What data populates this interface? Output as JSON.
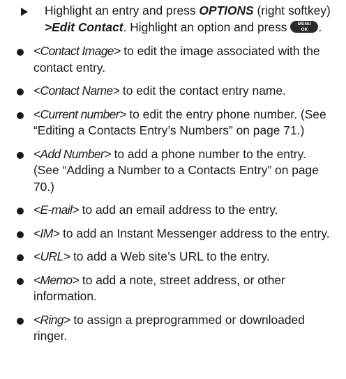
{
  "step": {
    "part1": "Highlight an entry and press ",
    "options_label": "OPTIONS",
    "part2": " (right softkey) ",
    "edit_contact_label": ">Edit Contact",
    "part3": ". Highlight an option and press ",
    "menu_key_top": "MENU",
    "menu_key_bottom": "OK",
    "part4": "."
  },
  "options": [
    {
      "token": "<Contact Image>",
      "desc": " to edit the image associated with the contact entry."
    },
    {
      "token": "<Contact Name>",
      "desc": " to edit the contact entry name."
    },
    {
      "token": "<Current number>",
      "desc": " to edit the entry phone number. (See “Editing a Contacts Entry’s Numbers” on page 71.)"
    },
    {
      "token": "<Add Number>",
      "desc": " to add a phone number to the entry. (See “Adding a Number to a Contacts Entry” on page 70.)"
    },
    {
      "token": "<E-mail>",
      "desc": " to add an email address to the entry."
    },
    {
      "token": "<IM>",
      "desc": " to add an Instant Messenger address to the entry."
    },
    {
      "token": "<URL>",
      "desc": " to add a Web site’s URL to the entry."
    },
    {
      "token": "<Memo>",
      "desc": " to add a note, street address, or other information."
    },
    {
      "token": "<Ring>",
      "desc": " to assign a preprogrammed or downloaded ringer."
    }
  ]
}
